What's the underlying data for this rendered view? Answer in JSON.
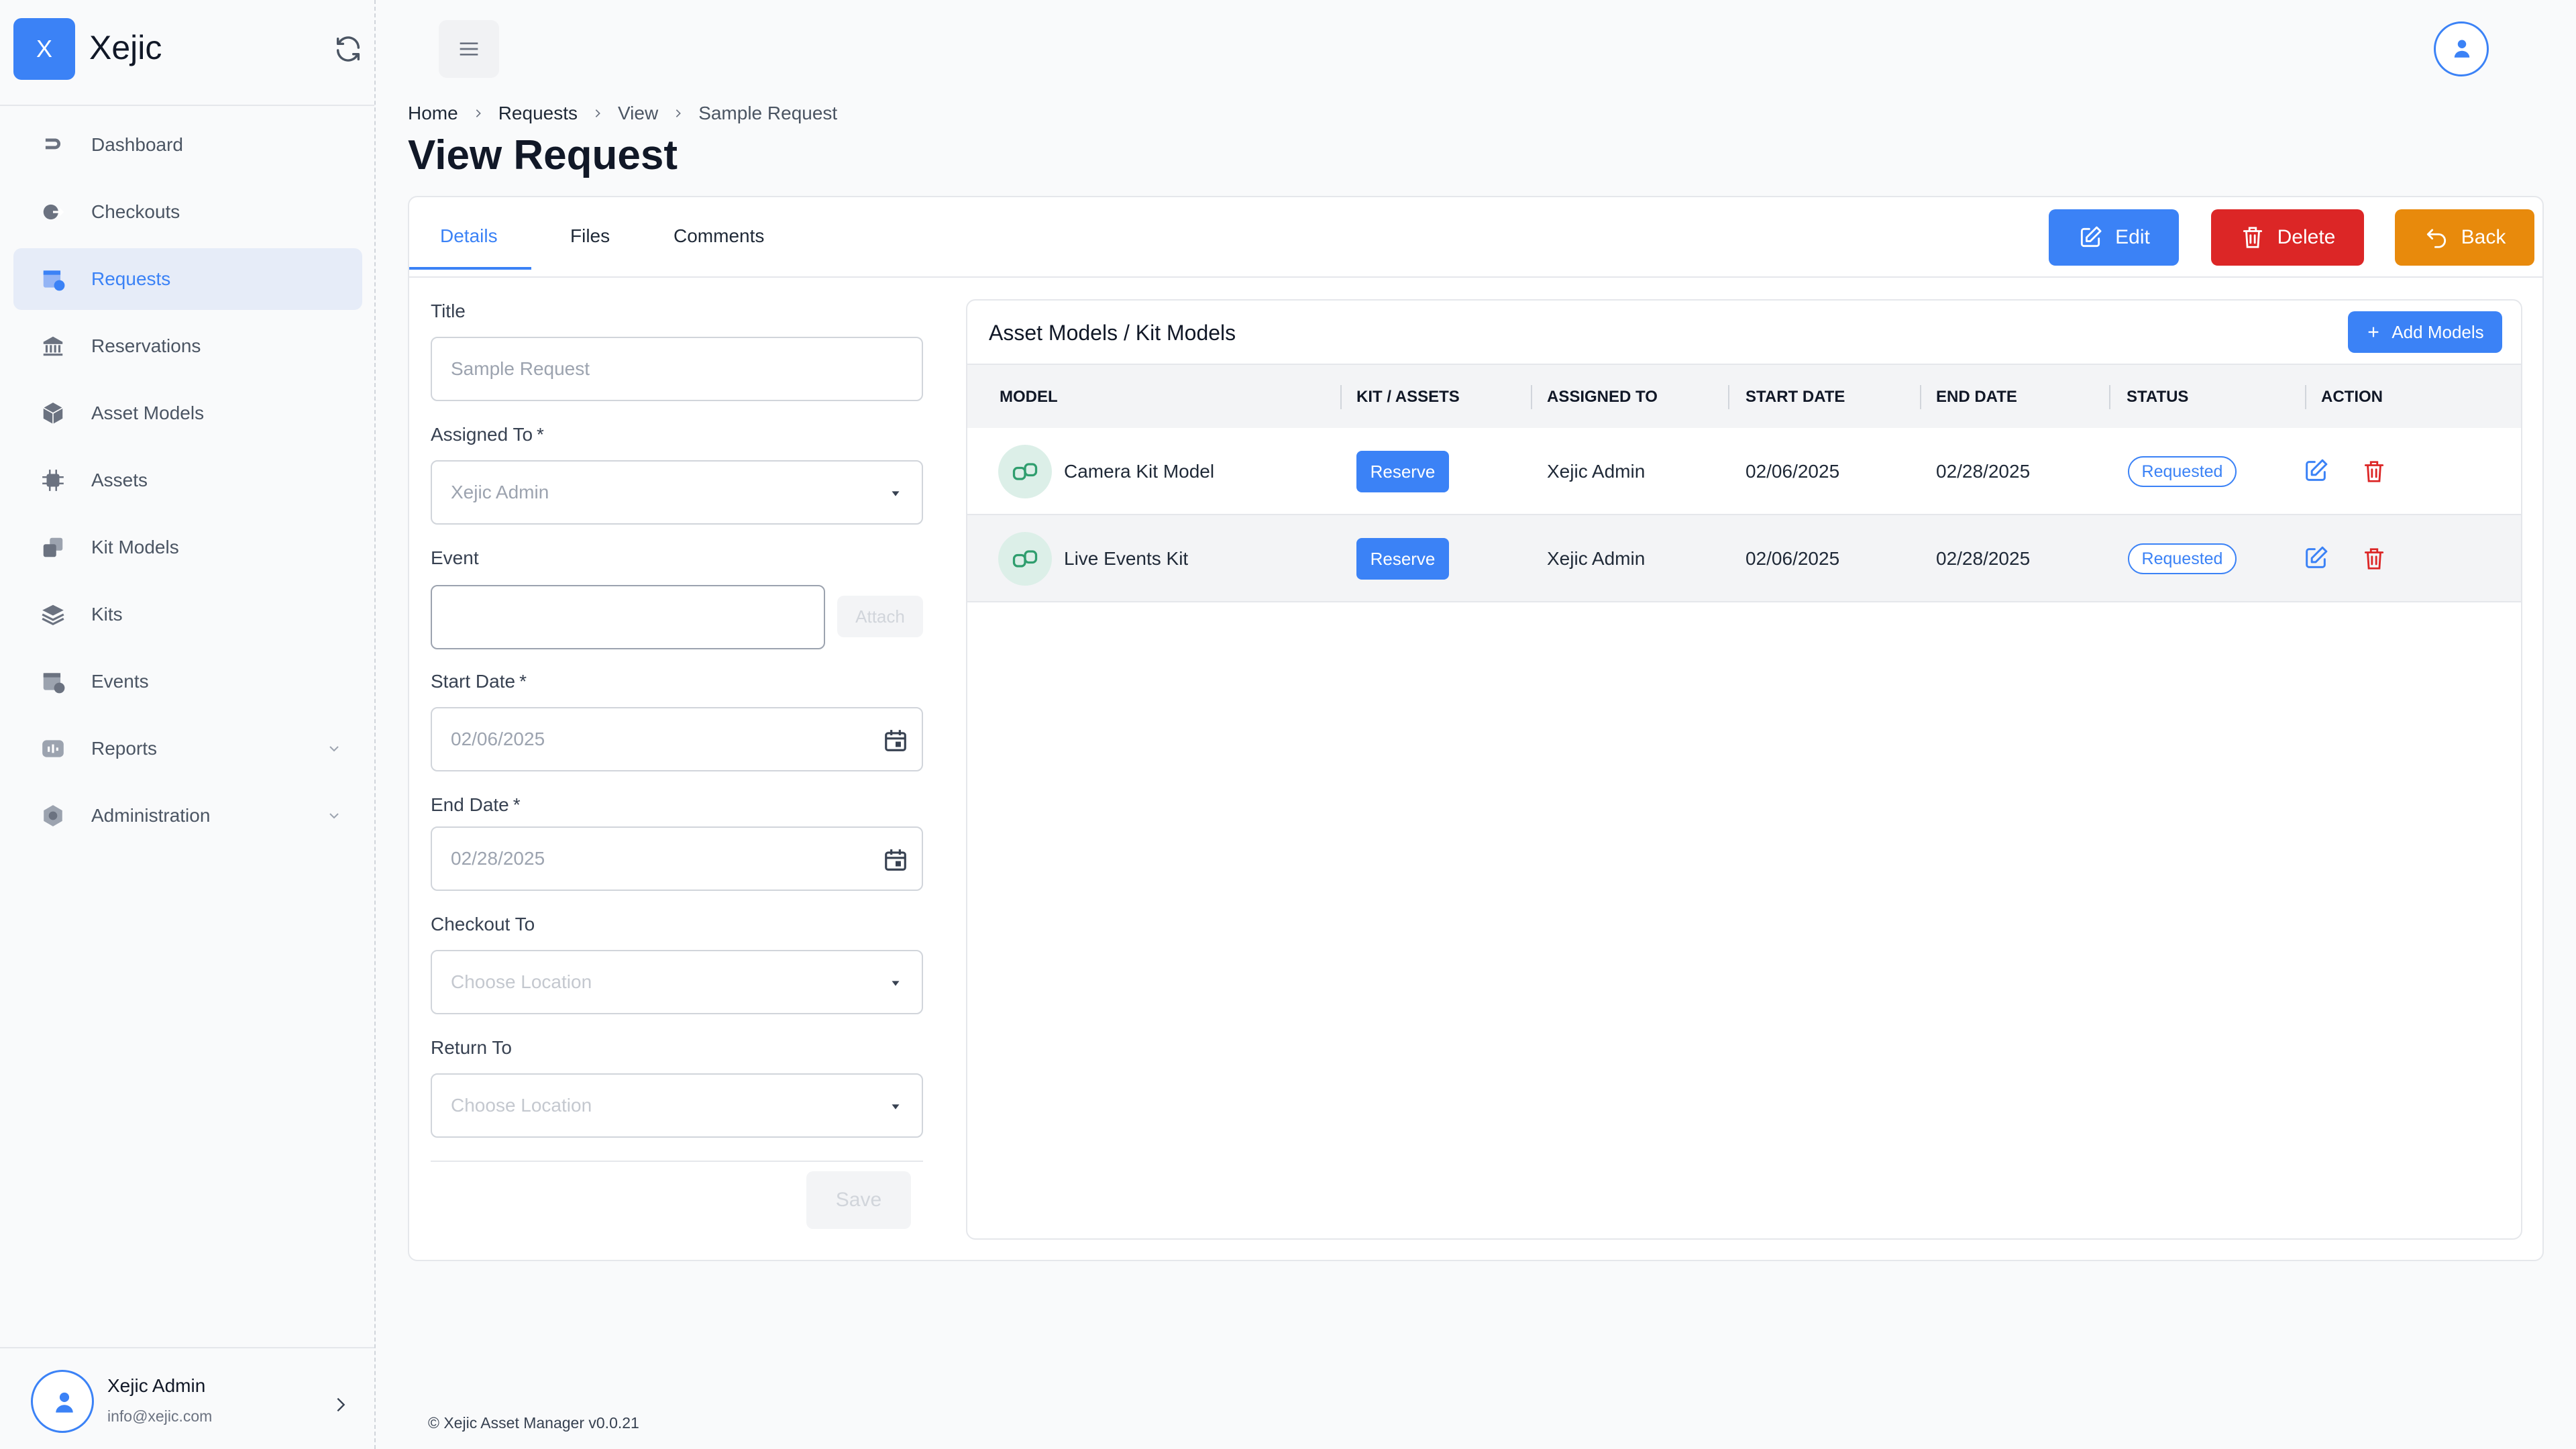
{
  "app": {
    "logo_letter": "X",
    "name": "Xejic"
  },
  "sidebar": {
    "items": [
      {
        "label": "Dashboard",
        "icon": "dashboard-icon"
      },
      {
        "label": "Checkouts",
        "icon": "checkout-icon"
      },
      {
        "label": "Requests",
        "icon": "requests-icon",
        "active": true
      },
      {
        "label": "Reservations",
        "icon": "reservations-icon"
      },
      {
        "label": "Asset Models",
        "icon": "asset-models-icon"
      },
      {
        "label": "Assets",
        "icon": "assets-icon"
      },
      {
        "label": "Kit Models",
        "icon": "kit-models-icon"
      },
      {
        "label": "Kits",
        "icon": "kits-icon"
      },
      {
        "label": "Events",
        "icon": "events-icon"
      },
      {
        "label": "Reports",
        "icon": "reports-icon",
        "expandable": true
      },
      {
        "label": "Administration",
        "icon": "administration-icon",
        "expandable": true
      }
    ],
    "user": {
      "name": "Xejic Admin",
      "email": "info@xejic.com"
    }
  },
  "breadcrumb": [
    "Home",
    "Requests",
    "View",
    "Sample Request"
  ],
  "page": {
    "title": "View Request"
  },
  "tabs": [
    "Details",
    "Files",
    "Comments"
  ],
  "actions": {
    "edit": "Edit",
    "delete": "Delete",
    "back": "Back"
  },
  "form": {
    "title_label": "Title",
    "title_value": "Sample Request",
    "assigned_label": "Assigned To",
    "assigned_value": "Xejic Admin",
    "required_mark": "*",
    "event_label": "Event",
    "event_value": "",
    "attach": "Attach",
    "start_label": "Start Date",
    "start_value": "02/06/2025",
    "end_label": "End Date",
    "end_value": "02/28/2025",
    "checkout_label": "Checkout To",
    "checkout_placeholder": "Choose Location",
    "return_label": "Return To",
    "return_placeholder": "Choose Location",
    "save": "Save"
  },
  "models": {
    "title": "Asset Models / Kit Models",
    "add_button": "Add Models",
    "columns": [
      "MODEL",
      "KIT / ASSETS",
      "ASSIGNED TO",
      "START DATE",
      "END DATE",
      "STATUS",
      "ACTION"
    ],
    "rows": [
      {
        "model": "Camera Kit Model",
        "kit_action": "Reserve",
        "assigned_to": "Xejic Admin",
        "start": "02/06/2025",
        "end": "02/28/2025",
        "status": "Requested"
      },
      {
        "model": "Live Events Kit",
        "kit_action": "Reserve",
        "assigned_to": "Xejic Admin",
        "start": "02/06/2025",
        "end": "02/28/2025",
        "status": "Requested"
      }
    ]
  },
  "footer": {
    "copyright": "© Xejic Asset Manager v0.0.21"
  },
  "colors": {
    "primary": "#3b82f6",
    "danger": "#dc2626",
    "warning": "#e88a0c",
    "model_icon_bg": "#dcefe8"
  }
}
